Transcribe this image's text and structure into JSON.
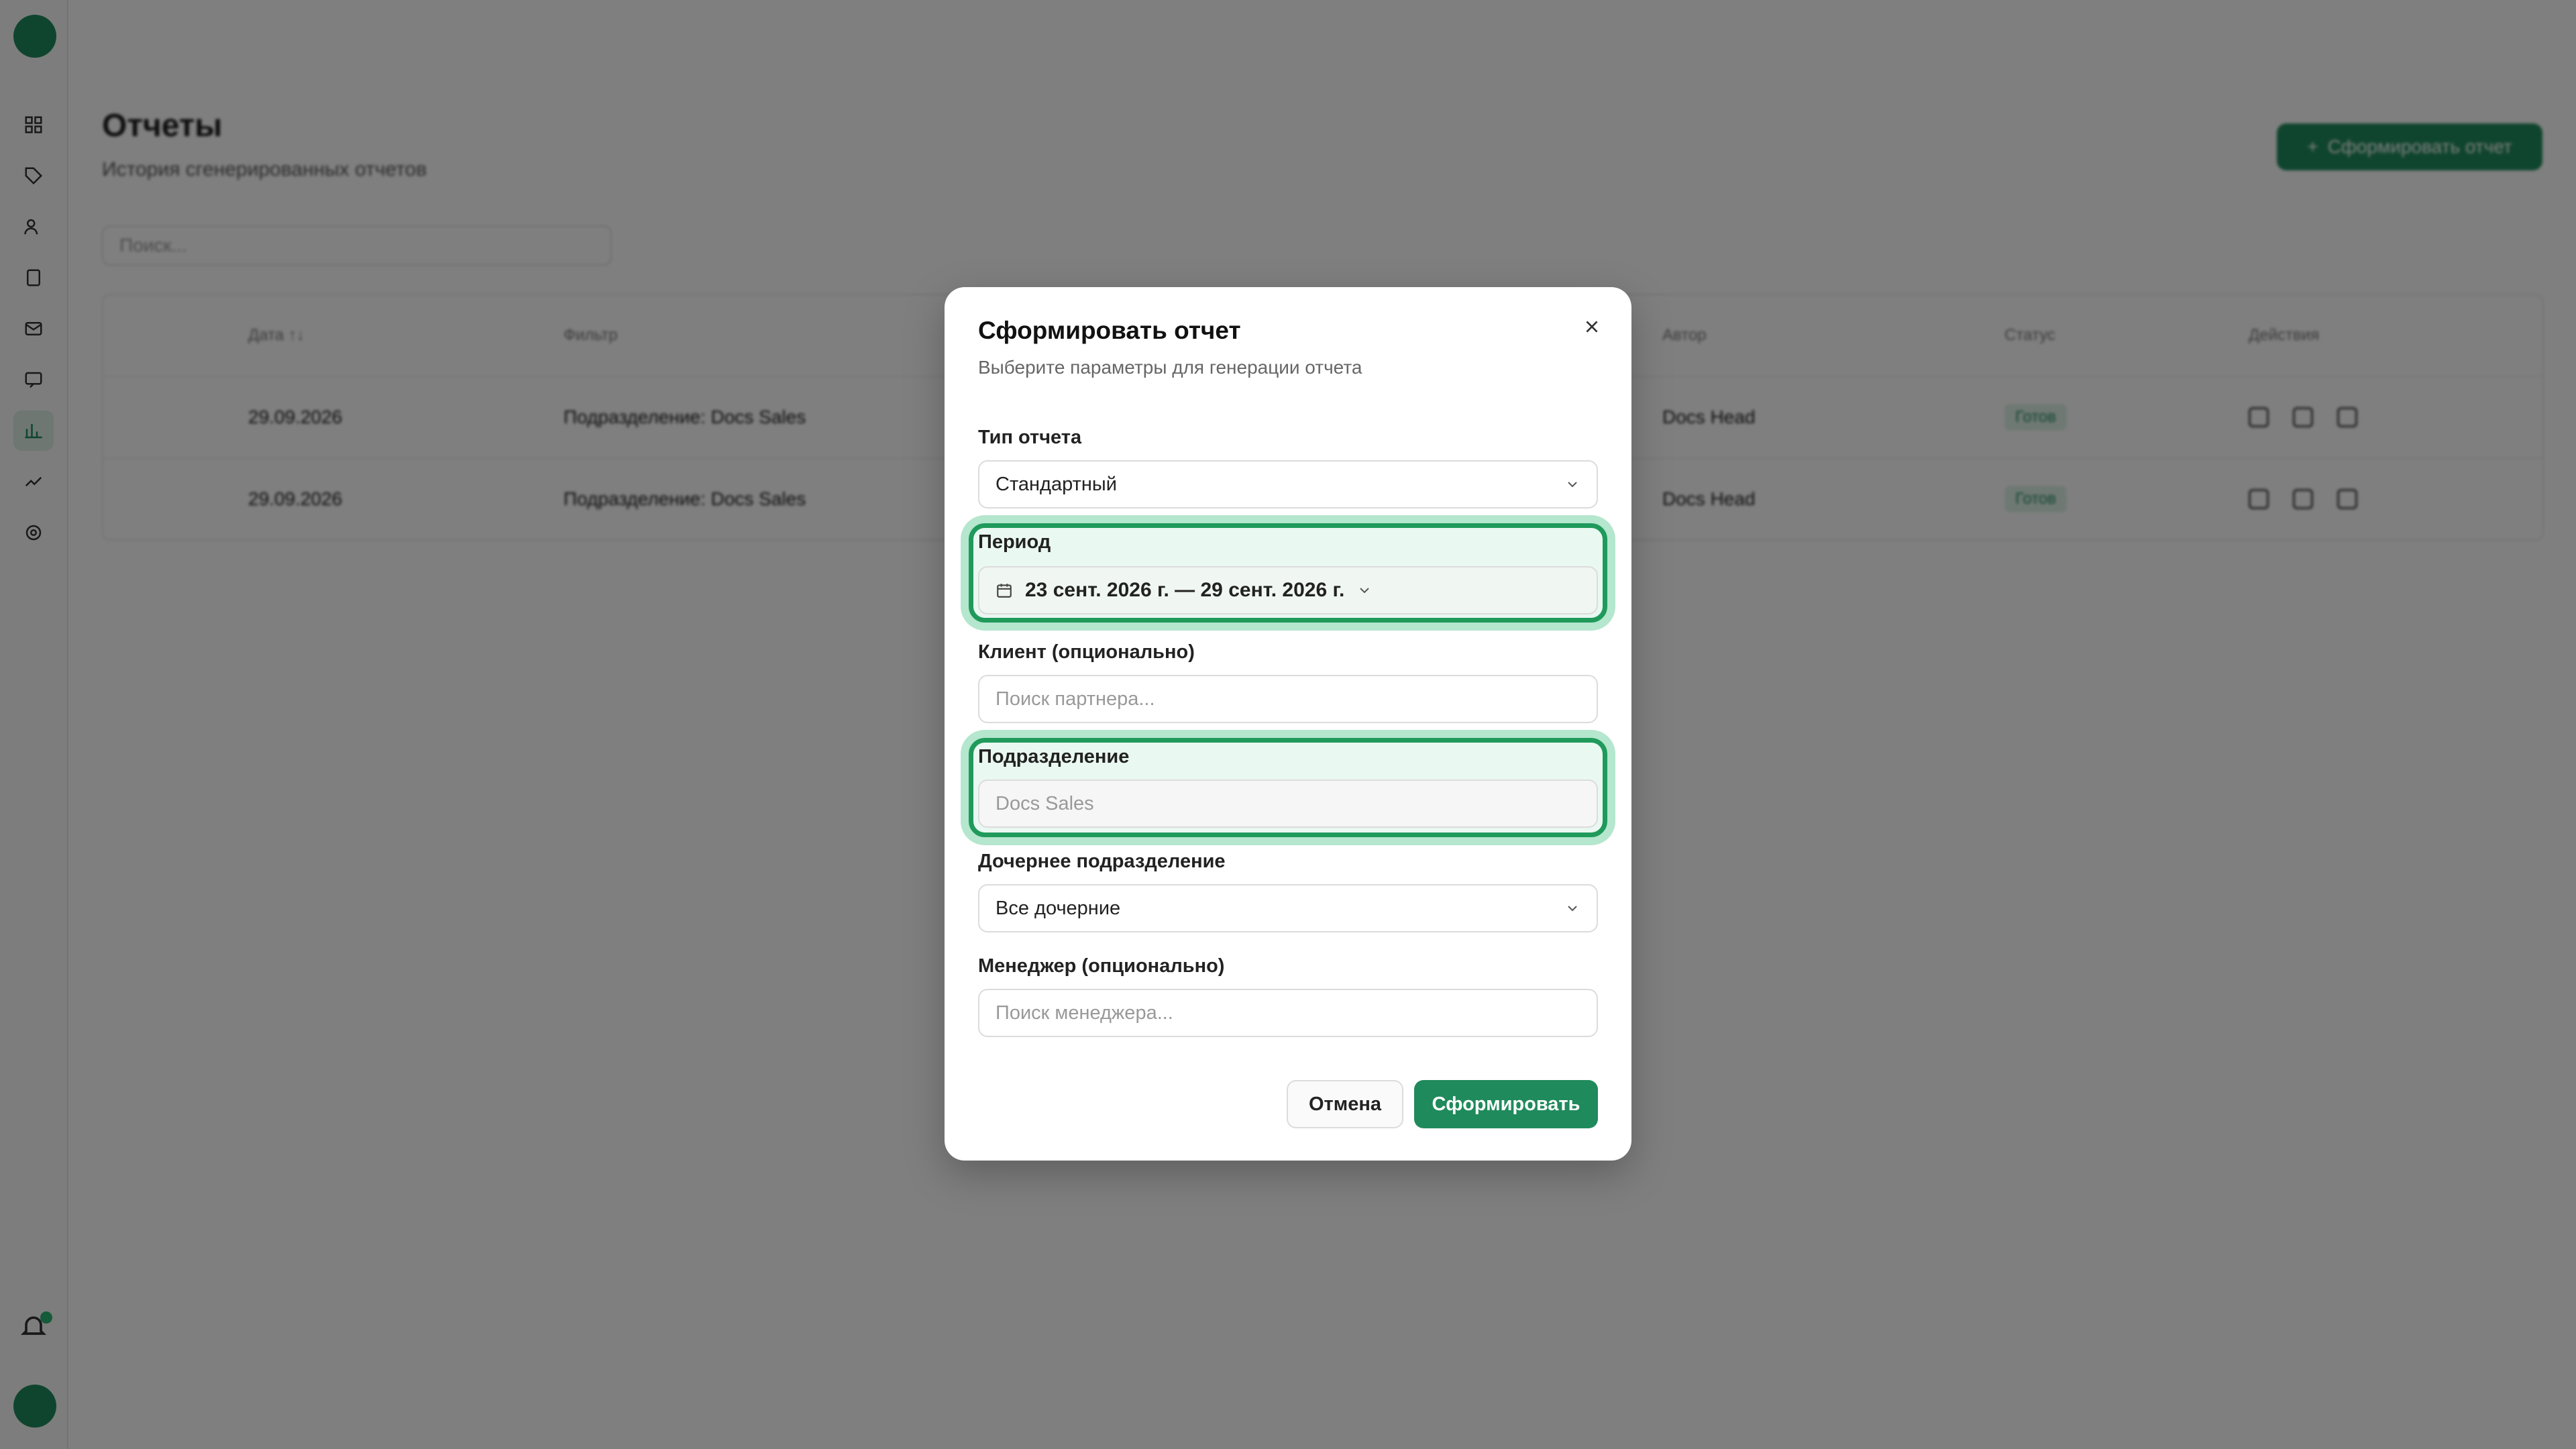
{
  "sidebar": {
    "logo_text": "",
    "avatar_text": ""
  },
  "page": {
    "title": "Отчеты",
    "subtitle": "История сгенерированных отчетов",
    "new_report_label": "Сформировать отчет",
    "search_placeholder": "Поиск..."
  },
  "table": {
    "columns": [
      "Дата ↑↓",
      "Фильтр",
      "Автор",
      "Статус",
      "Действия"
    ],
    "rows": [
      {
        "date": "29.09.2026",
        "filter": "Подразделение: Docs Sales",
        "author": "Docs Head",
        "status": "Готов"
      },
      {
        "date": "29.09.2026",
        "filter": "Подразделение: Docs Sales",
        "author": "Docs Head",
        "status": "Готов"
      }
    ]
  },
  "modal": {
    "title": "Сформировать отчет",
    "description": "Выберите параметры для генерации отчета",
    "report_type": {
      "label": "Тип отчета",
      "value": "Стандартный"
    },
    "period": {
      "label": "Период",
      "value": "23 сент. 2026 г. — 29 сент. 2026 г."
    },
    "client": {
      "label": "Клиент (опционально)",
      "placeholder": "Поиск партнера..."
    },
    "department": {
      "label": "Подразделение",
      "value": "Docs Sales"
    },
    "sub_department": {
      "label": "Дочернее подразделение",
      "value": "Все дочерние"
    },
    "manager": {
      "label": "Менеджер (опционально)",
      "placeholder": "Поиск менеджера..."
    },
    "cancel_label": "Отмена",
    "submit_label": "Сформировать"
  },
  "colors": {
    "accent": "#1f8a5c",
    "highlight": "#1f9a5a"
  }
}
